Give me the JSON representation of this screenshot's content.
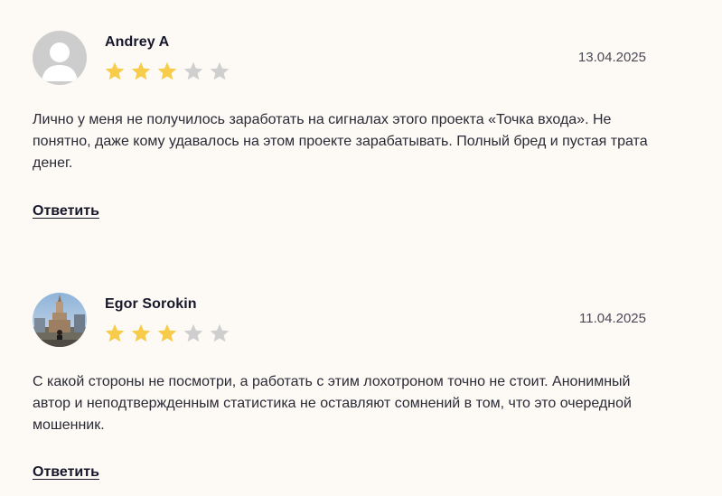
{
  "reviews": [
    {
      "author": "Andrey A",
      "avatar": "default-user-avatar",
      "rating": 3,
      "max_rating": 5,
      "date": "13.04.2025",
      "text": "Лично у меня не получилось заработать на сигналах этого проекта «Точка входа». Не понятно, даже кому удавалось на этом проекте зарабатывать. Полный бред и пустая трата денег.",
      "reply_label": "Ответить"
    },
    {
      "author": "Egor Sorokin",
      "avatar": "photo-avatar",
      "rating": 3,
      "max_rating": 5,
      "date": "11.04.2025",
      "text": "С какой стороны не посмотри, а работать с этим лохотроном точно не стоит. Анонимный автор и неподтвержденным статистика не оставляют сомнений в том, что это очередной мошенник.",
      "reply_label": "Ответить"
    }
  ],
  "colors": {
    "background": "#fdfaf6",
    "star_filled": "#f7cc4a",
    "star_empty": "#cfcfcf",
    "text": "#2a2a35"
  }
}
